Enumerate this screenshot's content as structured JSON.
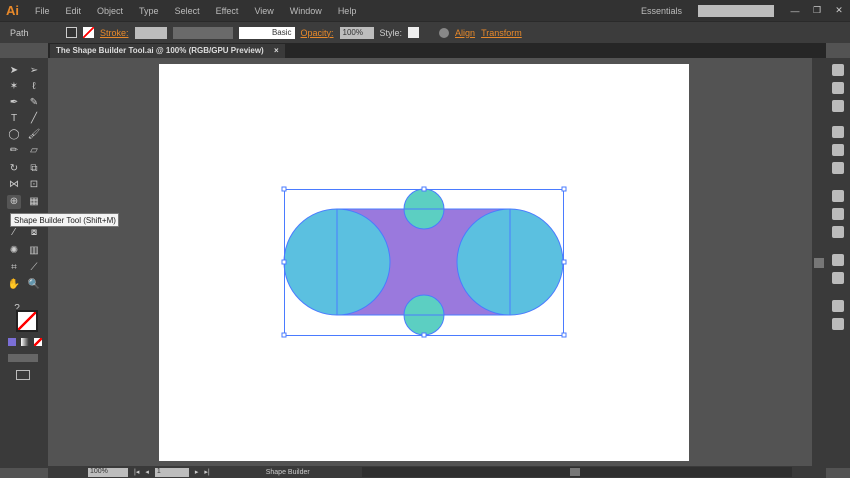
{
  "app": {
    "logo": "Ai",
    "menus": [
      "File",
      "Edit",
      "Object",
      "Type",
      "Select",
      "Effect",
      "View",
      "Window",
      "Help"
    ],
    "workspace": "Essentials",
    "search_placeholder": ""
  },
  "control": {
    "selection": "Path",
    "stroke_label": "Stroke:",
    "brush": "Basic",
    "opacity_label": "Opacity:",
    "opacity": "100%",
    "style_label": "Style:",
    "align": "Align",
    "transform": "Transform"
  },
  "document": {
    "tab": "The Shape Builder Tool.ai @ 100% (RGB/GPU Preview)",
    "close": "×"
  },
  "tooltip": "Shape Builder Tool (Shift+M)",
  "status": {
    "zoom": "100%",
    "page": "1",
    "tool": "Shape Builder"
  },
  "colors": {
    "purple": "#9a79dd",
    "cyan": "#5bc0e0",
    "teal": "#5ccfc2",
    "selection": "#4a7bff"
  }
}
